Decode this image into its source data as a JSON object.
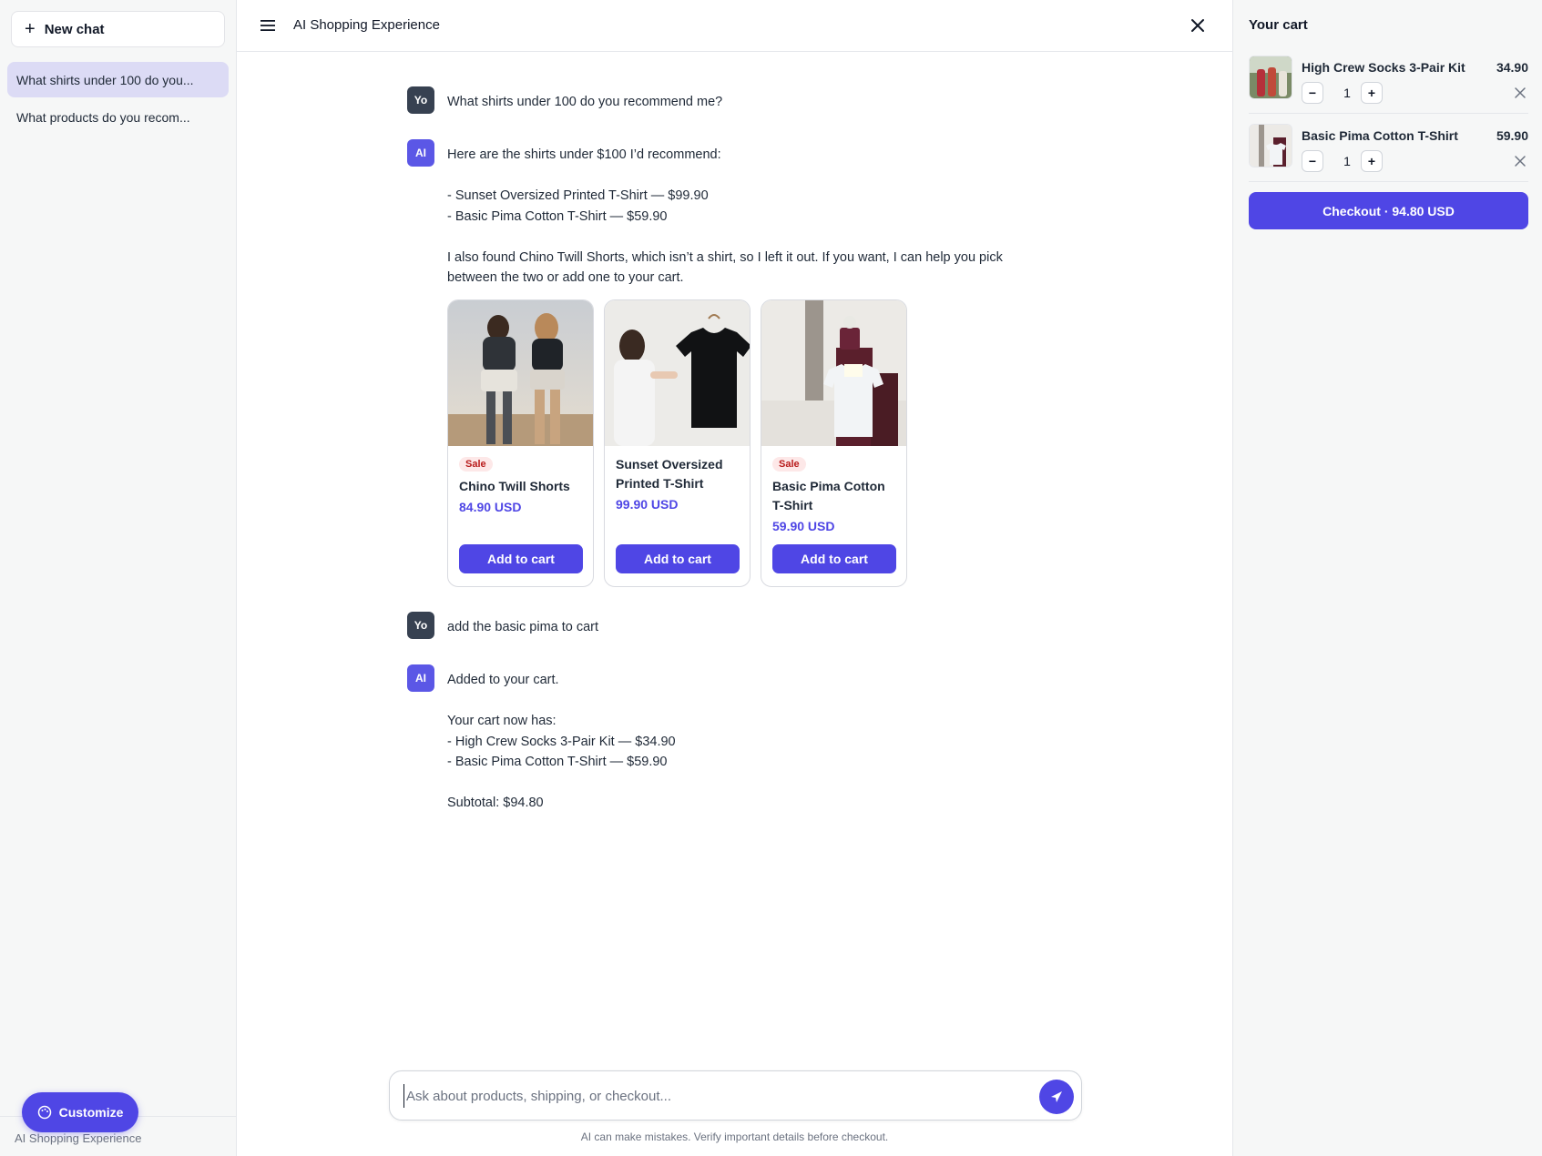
{
  "sidebar": {
    "new_chat_label": "New chat",
    "history": [
      {
        "label": "What shirts under 100 do you...",
        "active": true
      },
      {
        "label": "What products do you recom...",
        "active": false
      }
    ],
    "customize_label": "Customize",
    "footer_text": "AI Shopping Experience"
  },
  "header": {
    "title": "AI Shopping Experience"
  },
  "messages": [
    {
      "role": "user",
      "avatar": "Yo",
      "lines": [
        "What shirts under 100 do you recommend me?"
      ]
    },
    {
      "role": "ai",
      "avatar": "AI",
      "lines": [
        "Here are the shirts under $100 I’d recommend:",
        "",
        "- Sunset Oversized Printed T-Shirt — $99.90",
        "- Basic Pima Cotton T-Shirt — $59.90",
        "",
        "I also found Chino Twill Shorts, which isn’t a shirt, so I left it out. If you want, I can help you pick",
        "between the two or add one to your cart."
      ]
    },
    {
      "role": "user",
      "avatar": "Yo",
      "lines": [
        "add the basic pima to cart"
      ]
    },
    {
      "role": "ai",
      "avatar": "AI",
      "lines": [
        "Added to your cart.",
        "",
        "Your cart now has:",
        "- High Crew Socks 3-Pair Kit — $34.90",
        "- Basic Pima Cotton T-Shirt — $59.90",
        "",
        "Subtotal: $94.80"
      ]
    }
  ],
  "products": [
    {
      "name": "Chino Twill Shorts",
      "price": "84.90 USD",
      "badge": "Sale",
      "button": "Add to cart"
    },
    {
      "name": "Sunset Oversized Printed T-Shirt",
      "price": "99.90 USD",
      "badge": "",
      "button": "Add to cart"
    },
    {
      "name": "Basic Pima Cotton T-Shirt",
      "price": "59.90 USD",
      "badge": "Sale",
      "button": "Add to cart"
    }
  ],
  "composer": {
    "placeholder": "Ask about products, shipping, or checkout...",
    "value": ""
  },
  "disclaimer": "AI can make mistakes. Verify important details before checkout.",
  "cart": {
    "title": "Your cart",
    "items": [
      {
        "name": "High Crew Socks 3-Pair Kit",
        "price": "34.90",
        "qty": "1"
      },
      {
        "name": "Basic Pima Cotton T-Shirt",
        "price": "59.90",
        "qty": "1"
      }
    ],
    "checkout_label": "Checkout · 94.80 USD"
  },
  "colors": {
    "accent": "#4f46e5",
    "active_history_bg": "#dcdbf5",
    "sale_badge_text": "#b91c1c",
    "sale_badge_bg": "#fde8e8"
  }
}
